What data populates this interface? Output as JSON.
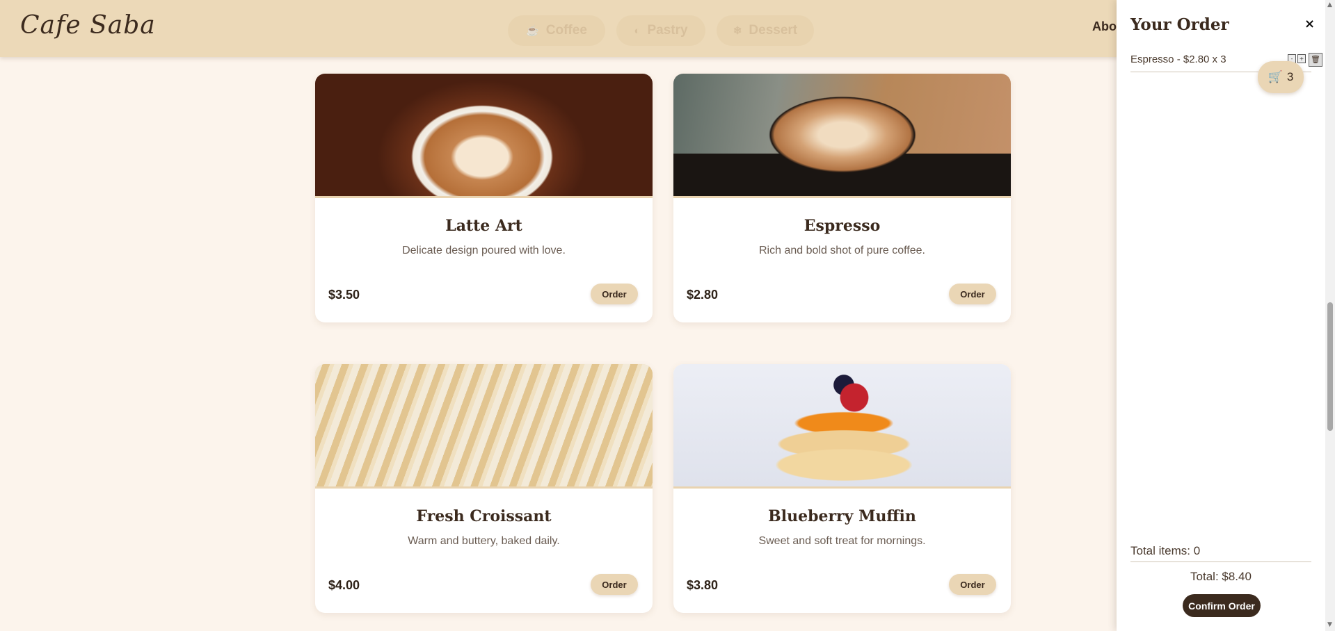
{
  "header": {
    "logo": "Cafe Saba",
    "categories": [
      {
        "label": "Coffee",
        "icon": "coffee-icon",
        "glyph": "☕"
      },
      {
        "label": "Pastry",
        "icon": "pastry-icon",
        "glyph": "◐"
      },
      {
        "label": "Dessert",
        "icon": "dessert-icon",
        "glyph": "❄"
      }
    ],
    "nav_about": "About"
  },
  "products": [
    {
      "title": "Latte Art",
      "desc": "Delicate design poured with love.",
      "price": "$3.50",
      "order_label": "Order"
    },
    {
      "title": "Espresso",
      "desc": "Rich and bold shot of pure coffee.",
      "price": "$2.80",
      "order_label": "Order"
    },
    {
      "title": "Fresh Croissant",
      "desc": "Warm and buttery, baked daily.",
      "price": "$4.00",
      "order_label": "Order"
    },
    {
      "title": "Blueberry Muffin",
      "desc": "Sweet and soft treat for mornings.",
      "price": "$3.80",
      "order_label": "Order"
    }
  ],
  "order_panel": {
    "title": "Your Order",
    "close": "×",
    "items": [
      {
        "text": "Espresso - $2.80 x 3"
      }
    ],
    "cart_count": "3",
    "cart_icon": "🛒",
    "total_items": "Total items: 0",
    "total": "Total: $8.40",
    "confirm_label": "Confirm Order"
  },
  "colors": {
    "background": "#fcf4ec",
    "header": "#ecd9b8",
    "accent": "#ead6b5",
    "dark": "#3b2a1e"
  }
}
